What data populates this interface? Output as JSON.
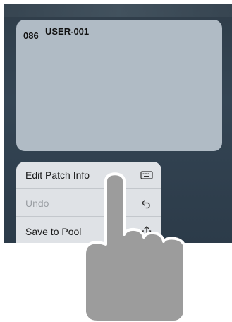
{
  "patch": {
    "number": "086",
    "name": "USER-001"
  },
  "context_menu": {
    "items": [
      {
        "label": "Edit Patch Info",
        "icon": "keyboard-icon",
        "enabled": true
      },
      {
        "label": "Undo",
        "icon": "undo-icon",
        "enabled": false
      },
      {
        "label": "Save to Pool",
        "icon": "share-icon",
        "enabled": true
      }
    ]
  },
  "colors": {
    "background": "#344554",
    "card": "#b0bbc5",
    "menu": "#dfe2e6",
    "hand": "#9c9c9c"
  }
}
